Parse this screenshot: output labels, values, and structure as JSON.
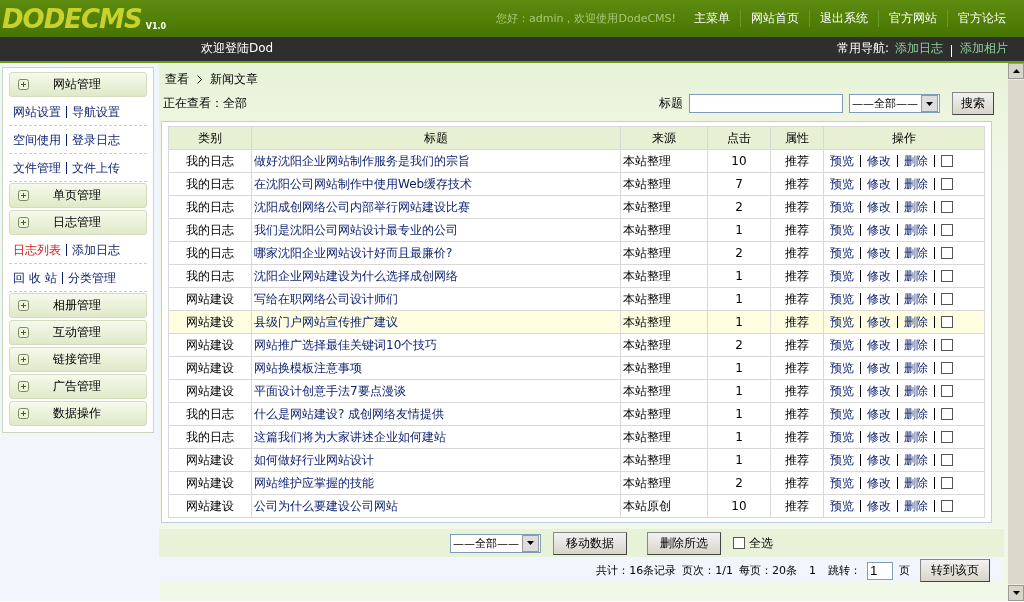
{
  "header": {
    "logo": "DODECMS",
    "version": "V1.0",
    "greeting": "您好：admin，欢迎使用DodeCMS!",
    "nav": [
      "主菜单",
      "网站首页",
      "退出系统",
      "官方网站",
      "官方论坛"
    ]
  },
  "subheader": {
    "welcome": "欢迎登陆Dod",
    "quick_label": "常用导航:",
    "quick_links": [
      "添加日志",
      "添加相片"
    ]
  },
  "sidebar": [
    {
      "label": "网站管理",
      "links": [
        [
          {
            "label": "网站设置",
            "selected": false
          },
          {
            "label": "导航设置",
            "selected": false
          }
        ],
        [
          {
            "label": "空间使用",
            "selected": false
          },
          {
            "label": "登录日志",
            "selected": false
          }
        ],
        [
          {
            "label": "文件管理",
            "selected": false
          },
          {
            "label": "文件上传",
            "selected": false
          }
        ]
      ]
    },
    {
      "label": "单页管理"
    },
    {
      "label": "日志管理",
      "links": [
        [
          {
            "label": "日志列表",
            "selected": true
          },
          {
            "label": "添加日志",
            "selected": false
          }
        ],
        [
          {
            "label": "回 收 站",
            "selected": false
          },
          {
            "label": "分类管理",
            "selected": false
          }
        ]
      ]
    },
    {
      "label": "相册管理"
    },
    {
      "label": "互动管理"
    },
    {
      "label": "链接管理"
    },
    {
      "label": "广告管理"
    },
    {
      "label": "数据操作"
    }
  ],
  "breadcrumb": [
    "查看",
    "新闻文章"
  ],
  "viewing": "正在查看：全部",
  "search": {
    "label": "标题",
    "category": "——全部——",
    "button": "搜索"
  },
  "table": {
    "columns": [
      "类别",
      "标题",
      "来源",
      "点击",
      "属性",
      "操作"
    ],
    "rows": [
      {
        "category": "我的日志",
        "title": "做好沈阳企业网站制作服务是我们的宗旨",
        "source": "本站整理",
        "hits": "10",
        "attr": "推荐",
        "actions": [
          "预览",
          "修改",
          "删除"
        ],
        "selected": false,
        "checked": false
      },
      {
        "category": "我的日志",
        "title": "在沈阳公司网站制作中使用Web缓存技术",
        "source": "本站整理",
        "hits": "7",
        "attr": "推荐",
        "actions": [
          "预览",
          "修改",
          "删除"
        ],
        "selected": false,
        "checked": false
      },
      {
        "category": "我的日志",
        "title": "沈阳成创网络公司内部举行网站建设比赛",
        "source": "本站整理",
        "hits": "2",
        "attr": "推荐",
        "actions": [
          "预览",
          "修改",
          "删除"
        ],
        "selected": false,
        "checked": false
      },
      {
        "category": "我的日志",
        "title": "我们是沈阳公司网站设计最专业的公司",
        "source": "本站整理",
        "hits": "1",
        "attr": "推荐",
        "actions": [
          "预览",
          "修改",
          "删除"
        ],
        "selected": false,
        "checked": false
      },
      {
        "category": "我的日志",
        "title": "哪家沈阳企业网站设计好而且最廉价?",
        "source": "本站整理",
        "hits": "2",
        "attr": "推荐",
        "actions": [
          "预览",
          "修改",
          "删除"
        ],
        "selected": false,
        "checked": false
      },
      {
        "category": "我的日志",
        "title": "沈阳企业网站建设为什么选择成创网络",
        "source": "本站整理",
        "hits": "1",
        "attr": "推荐",
        "actions": [
          "预览",
          "修改",
          "删除"
        ],
        "selected": false,
        "checked": false
      },
      {
        "category": "网站建设",
        "title": "写给在职网络公司设计师们",
        "source": "本站整理",
        "hits": "1",
        "attr": "推荐",
        "actions": [
          "预览",
          "修改",
          "删除"
        ],
        "selected": false,
        "checked": false
      },
      {
        "category": "网站建设",
        "title": "县级门户网站宣传推广建议",
        "source": "本站整理",
        "hits": "1",
        "attr": "推荐",
        "actions": [
          "预览",
          "修改",
          "删除"
        ],
        "selected": true,
        "checked": false
      },
      {
        "category": "网站建设",
        "title": "网站推广选择最佳关键词10个技巧",
        "source": "本站整理",
        "hits": "2",
        "attr": "推荐",
        "actions": [
          "预览",
          "修改",
          "删除"
        ],
        "selected": false,
        "checked": false
      },
      {
        "category": "网站建设",
        "title": "网站换模板注意事项",
        "source": "本站整理",
        "hits": "1",
        "attr": "推荐",
        "actions": [
          "预览",
          "修改",
          "删除"
        ],
        "selected": false,
        "checked": false
      },
      {
        "category": "网站建设",
        "title": "平面设计创意手法7要点漫谈",
        "source": "本站整理",
        "hits": "1",
        "attr": "推荐",
        "actions": [
          "预览",
          "修改",
          "删除"
        ],
        "selected": false,
        "checked": false
      },
      {
        "category": "我的日志",
        "title": "什么是网站建设? 成创网络友情提供",
        "source": "本站整理",
        "hits": "1",
        "attr": "推荐",
        "actions": [
          "预览",
          "修改",
          "删除"
        ],
        "selected": false,
        "checked": false
      },
      {
        "category": "我的日志",
        "title": "这篇我们将为大家讲述企业如何建站",
        "source": "本站整理",
        "hits": "1",
        "attr": "推荐",
        "actions": [
          "预览",
          "修改",
          "删除"
        ],
        "selected": false,
        "checked": false
      },
      {
        "category": "网站建设",
        "title": "如何做好行业网站设计",
        "source": "本站整理",
        "hits": "1",
        "attr": "推荐",
        "actions": [
          "预览",
          "修改",
          "删除"
        ],
        "selected": false,
        "checked": false
      },
      {
        "category": "网站建设",
        "title": "网站维护应掌握的技能",
        "source": "本站整理",
        "hits": "2",
        "attr": "推荐",
        "actions": [
          "预览",
          "修改",
          "删除"
        ],
        "selected": false,
        "checked": false
      },
      {
        "category": "网站建设",
        "title": "公司为什么要建设公司网站",
        "source": "本站原创",
        "hits": "10",
        "attr": "推荐",
        "actions": [
          "预览",
          "修改",
          "删除"
        ],
        "selected": false,
        "checked": false
      }
    ]
  },
  "bulk": {
    "target": "——全部——",
    "move": "移动数据",
    "delete": "删除所选",
    "select_all": {
      "label": "全选",
      "checked": false
    }
  },
  "pager": {
    "total": "共计：16条记录",
    "page": "页次：1/1",
    "per_page": "每页：20条",
    "current": "1",
    "jump_label": "跳转：",
    "jump_value": "1",
    "page_unit": "页",
    "go": "转到该页"
  }
}
